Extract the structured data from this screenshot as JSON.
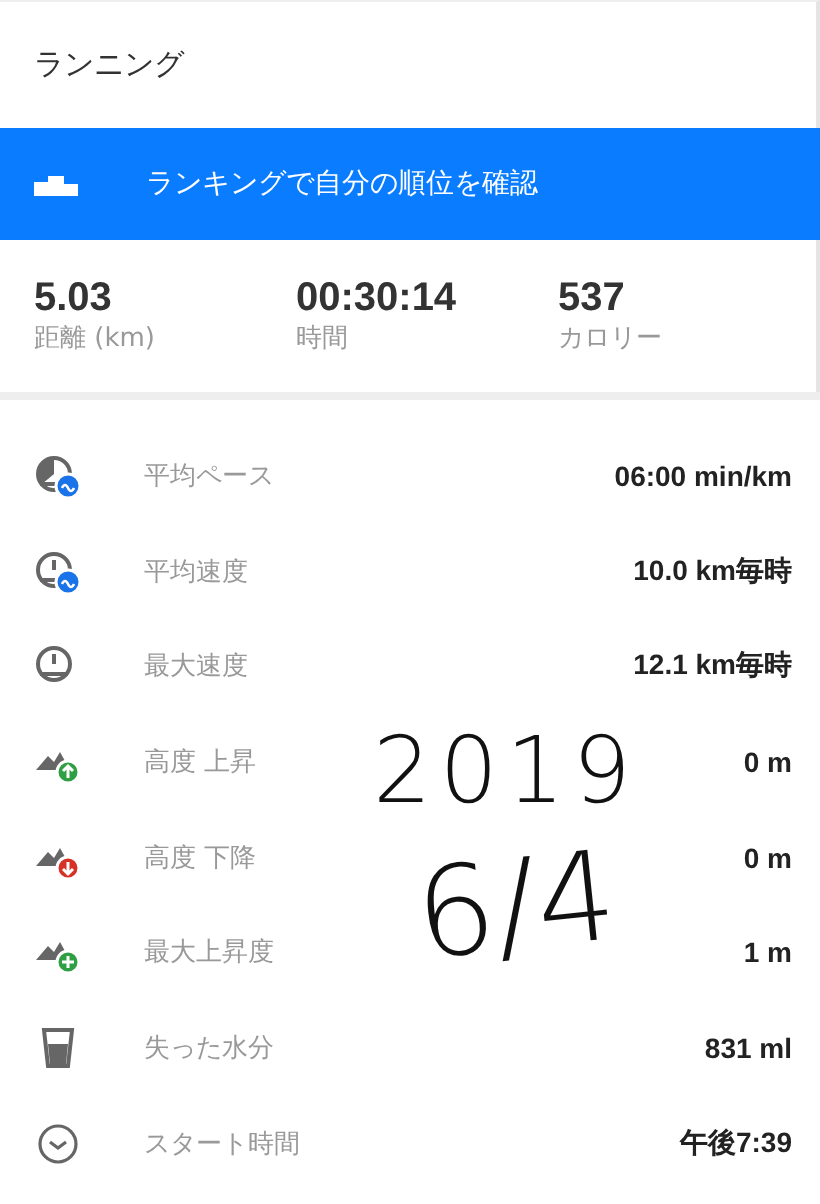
{
  "title": "ランニング",
  "banner": {
    "label": "ランキングで自分の順位を確認"
  },
  "stats": [
    {
      "value": "5.03",
      "label": "距離 (km)"
    },
    {
      "value": "00:30:14",
      "label": "時間"
    },
    {
      "value": "537",
      "label": "カロリー"
    }
  ],
  "metrics": [
    {
      "kind": "pace",
      "label": "平均ペース",
      "value": "06:00 min/km"
    },
    {
      "kind": "avg_speed",
      "label": "平均速度",
      "value": "10.0 km毎時"
    },
    {
      "kind": "max_speed",
      "label": "最大速度",
      "value": "12.1 km毎時"
    },
    {
      "kind": "ascent",
      "label": "高度 上昇",
      "value": "0 m"
    },
    {
      "kind": "descent",
      "label": "高度 下降",
      "value": "0 m"
    },
    {
      "kind": "max_ascent",
      "label": "最大上昇度",
      "value": "1 m"
    },
    {
      "kind": "water",
      "label": "失った水分",
      "value": "831 ml"
    },
    {
      "kind": "clock",
      "label": "スタート時間",
      "value": "午後7:39"
    }
  ],
  "handwritten_note": [
    "2019",
    "6/4"
  ]
}
